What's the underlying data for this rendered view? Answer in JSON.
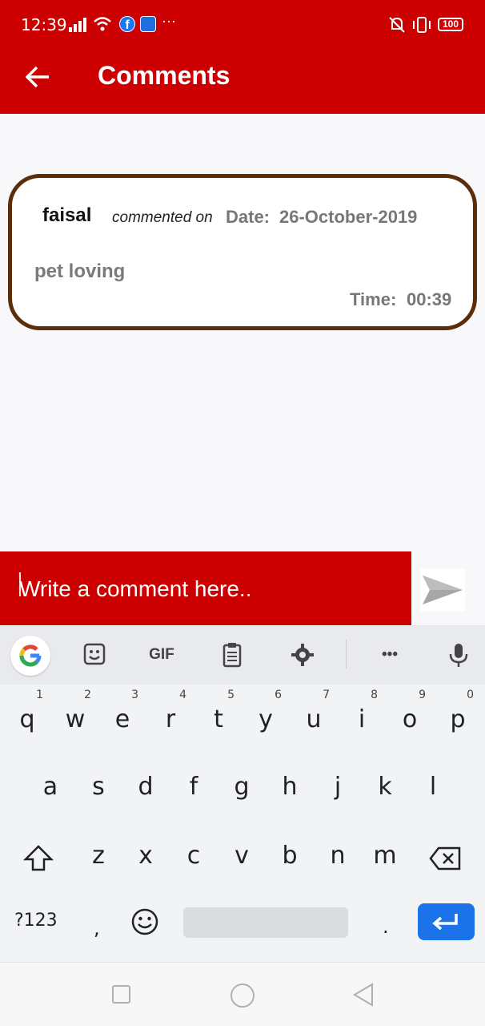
{
  "status_bar": {
    "time": "12:39",
    "battery": "100",
    "more": "···"
  },
  "app_bar": {
    "title": "Comments",
    "back_icon": "arrow-left-icon",
    "color": "#cc0000"
  },
  "comments": [
    {
      "author": "faisal",
      "action": "commented on",
      "date_label": "Date:",
      "date": "26-October-2019",
      "text": "pet loving",
      "time_label": "Time:",
      "time": "00:39"
    }
  ],
  "composer": {
    "placeholder": "Write a comment here..",
    "send_icon": "send-icon"
  },
  "keyboard": {
    "toolbar": {
      "google": "google-icon",
      "sticker": "sticker-icon",
      "gif": "GIF",
      "clipboard": "clipboard-icon",
      "settings": "gear-icon",
      "more": "•••",
      "mic": "microphone-icon"
    },
    "row1": [
      "q",
      "w",
      "e",
      "r",
      "t",
      "y",
      "u",
      "i",
      "o",
      "p"
    ],
    "row1_hints": [
      "1",
      "2",
      "3",
      "4",
      "5",
      "6",
      "7",
      "8",
      "9",
      "0"
    ],
    "row2": [
      "a",
      "s",
      "d",
      "f",
      "g",
      "h",
      "j",
      "k",
      "l"
    ],
    "row3": [
      "z",
      "x",
      "c",
      "v",
      "b",
      "n",
      "m"
    ],
    "symbols": "?123",
    "comma": ",",
    "period": "."
  },
  "nav_bar": {
    "recents": "square-icon",
    "home": "circle-icon",
    "back": "triangle-back-icon"
  }
}
